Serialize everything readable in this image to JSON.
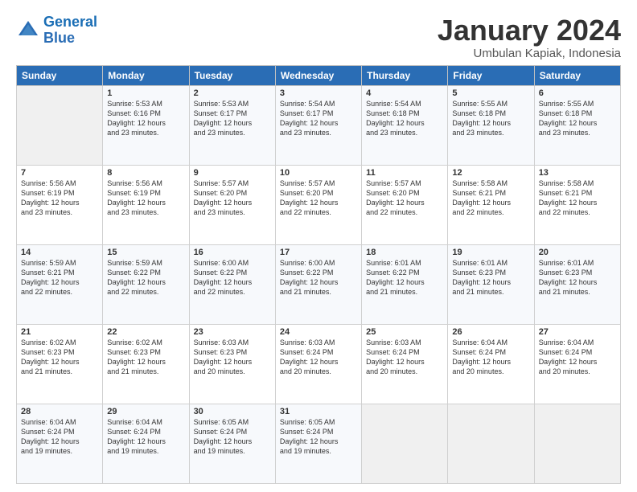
{
  "logo": {
    "line1": "General",
    "line2": "Blue"
  },
  "title": "January 2024",
  "location": "Umbulan Kapiak, Indonesia",
  "headers": [
    "Sunday",
    "Monday",
    "Tuesday",
    "Wednesday",
    "Thursday",
    "Friday",
    "Saturday"
  ],
  "weeks": [
    [
      {
        "day": "",
        "info": ""
      },
      {
        "day": "1",
        "info": "Sunrise: 5:53 AM\nSunset: 6:16 PM\nDaylight: 12 hours\nand 23 minutes."
      },
      {
        "day": "2",
        "info": "Sunrise: 5:53 AM\nSunset: 6:17 PM\nDaylight: 12 hours\nand 23 minutes."
      },
      {
        "day": "3",
        "info": "Sunrise: 5:54 AM\nSunset: 6:17 PM\nDaylight: 12 hours\nand 23 minutes."
      },
      {
        "day": "4",
        "info": "Sunrise: 5:54 AM\nSunset: 6:18 PM\nDaylight: 12 hours\nand 23 minutes."
      },
      {
        "day": "5",
        "info": "Sunrise: 5:55 AM\nSunset: 6:18 PM\nDaylight: 12 hours\nand 23 minutes."
      },
      {
        "day": "6",
        "info": "Sunrise: 5:55 AM\nSunset: 6:18 PM\nDaylight: 12 hours\nand 23 minutes."
      }
    ],
    [
      {
        "day": "7",
        "info": "Sunrise: 5:56 AM\nSunset: 6:19 PM\nDaylight: 12 hours\nand 23 minutes."
      },
      {
        "day": "8",
        "info": "Sunrise: 5:56 AM\nSunset: 6:19 PM\nDaylight: 12 hours\nand 23 minutes."
      },
      {
        "day": "9",
        "info": "Sunrise: 5:57 AM\nSunset: 6:20 PM\nDaylight: 12 hours\nand 23 minutes."
      },
      {
        "day": "10",
        "info": "Sunrise: 5:57 AM\nSunset: 6:20 PM\nDaylight: 12 hours\nand 22 minutes."
      },
      {
        "day": "11",
        "info": "Sunrise: 5:57 AM\nSunset: 6:20 PM\nDaylight: 12 hours\nand 22 minutes."
      },
      {
        "day": "12",
        "info": "Sunrise: 5:58 AM\nSunset: 6:21 PM\nDaylight: 12 hours\nand 22 minutes."
      },
      {
        "day": "13",
        "info": "Sunrise: 5:58 AM\nSunset: 6:21 PM\nDaylight: 12 hours\nand 22 minutes."
      }
    ],
    [
      {
        "day": "14",
        "info": "Sunrise: 5:59 AM\nSunset: 6:21 PM\nDaylight: 12 hours\nand 22 minutes."
      },
      {
        "day": "15",
        "info": "Sunrise: 5:59 AM\nSunset: 6:22 PM\nDaylight: 12 hours\nand 22 minutes."
      },
      {
        "day": "16",
        "info": "Sunrise: 6:00 AM\nSunset: 6:22 PM\nDaylight: 12 hours\nand 22 minutes."
      },
      {
        "day": "17",
        "info": "Sunrise: 6:00 AM\nSunset: 6:22 PM\nDaylight: 12 hours\nand 21 minutes."
      },
      {
        "day": "18",
        "info": "Sunrise: 6:01 AM\nSunset: 6:22 PM\nDaylight: 12 hours\nand 21 minutes."
      },
      {
        "day": "19",
        "info": "Sunrise: 6:01 AM\nSunset: 6:23 PM\nDaylight: 12 hours\nand 21 minutes."
      },
      {
        "day": "20",
        "info": "Sunrise: 6:01 AM\nSunset: 6:23 PM\nDaylight: 12 hours\nand 21 minutes."
      }
    ],
    [
      {
        "day": "21",
        "info": "Sunrise: 6:02 AM\nSunset: 6:23 PM\nDaylight: 12 hours\nand 21 minutes."
      },
      {
        "day": "22",
        "info": "Sunrise: 6:02 AM\nSunset: 6:23 PM\nDaylight: 12 hours\nand 21 minutes."
      },
      {
        "day": "23",
        "info": "Sunrise: 6:03 AM\nSunset: 6:23 PM\nDaylight: 12 hours\nand 20 minutes."
      },
      {
        "day": "24",
        "info": "Sunrise: 6:03 AM\nSunset: 6:24 PM\nDaylight: 12 hours\nand 20 minutes."
      },
      {
        "day": "25",
        "info": "Sunrise: 6:03 AM\nSunset: 6:24 PM\nDaylight: 12 hours\nand 20 minutes."
      },
      {
        "day": "26",
        "info": "Sunrise: 6:04 AM\nSunset: 6:24 PM\nDaylight: 12 hours\nand 20 minutes."
      },
      {
        "day": "27",
        "info": "Sunrise: 6:04 AM\nSunset: 6:24 PM\nDaylight: 12 hours\nand 20 minutes."
      }
    ],
    [
      {
        "day": "28",
        "info": "Sunrise: 6:04 AM\nSunset: 6:24 PM\nDaylight: 12 hours\nand 19 minutes."
      },
      {
        "day": "29",
        "info": "Sunrise: 6:04 AM\nSunset: 6:24 PM\nDaylight: 12 hours\nand 19 minutes."
      },
      {
        "day": "30",
        "info": "Sunrise: 6:05 AM\nSunset: 6:24 PM\nDaylight: 12 hours\nand 19 minutes."
      },
      {
        "day": "31",
        "info": "Sunrise: 6:05 AM\nSunset: 6:24 PM\nDaylight: 12 hours\nand 19 minutes."
      },
      {
        "day": "",
        "info": ""
      },
      {
        "day": "",
        "info": ""
      },
      {
        "day": "",
        "info": ""
      }
    ]
  ]
}
